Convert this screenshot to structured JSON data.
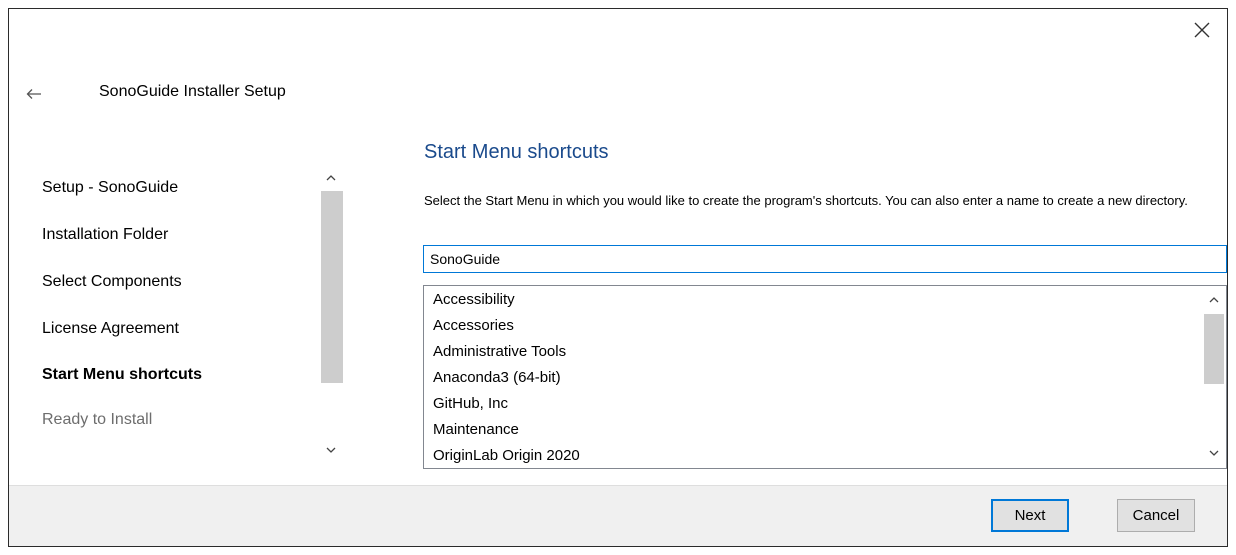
{
  "window": {
    "title": "SonoGuide Installer Setup"
  },
  "sidebar": {
    "items": [
      {
        "label": "Setup - SonoGuide",
        "state": "normal"
      },
      {
        "label": "Installation Folder",
        "state": "normal"
      },
      {
        "label": "Select Components",
        "state": "normal"
      },
      {
        "label": "License Agreement",
        "state": "normal"
      },
      {
        "label": "Start Menu shortcuts",
        "state": "active"
      },
      {
        "label": "Ready to Install",
        "state": "disabled"
      }
    ]
  },
  "main": {
    "page_title": "Start Menu shortcuts",
    "description": "Select the Start Menu in which you would like to create the program's shortcuts. You can also enter a name to create a new directory.",
    "folder_input": {
      "value": "SonoGuide"
    },
    "folders": [
      "Accessibility",
      "Accessories",
      "Administrative Tools",
      "Anaconda3 (64-bit)",
      "GitHub, Inc",
      "Maintenance",
      "OriginLab Origin 2020"
    ]
  },
  "footer": {
    "next_label": "Next",
    "cancel_label": "Cancel"
  },
  "colors": {
    "accent": "#0078d7",
    "heading": "#1a4a8c",
    "footer_bg": "#f0f0f0"
  },
  "icons": {
    "close": "close-icon",
    "back": "arrow-left-icon",
    "scroll_up": "chevron-up-icon",
    "scroll_down": "chevron-down-icon"
  }
}
